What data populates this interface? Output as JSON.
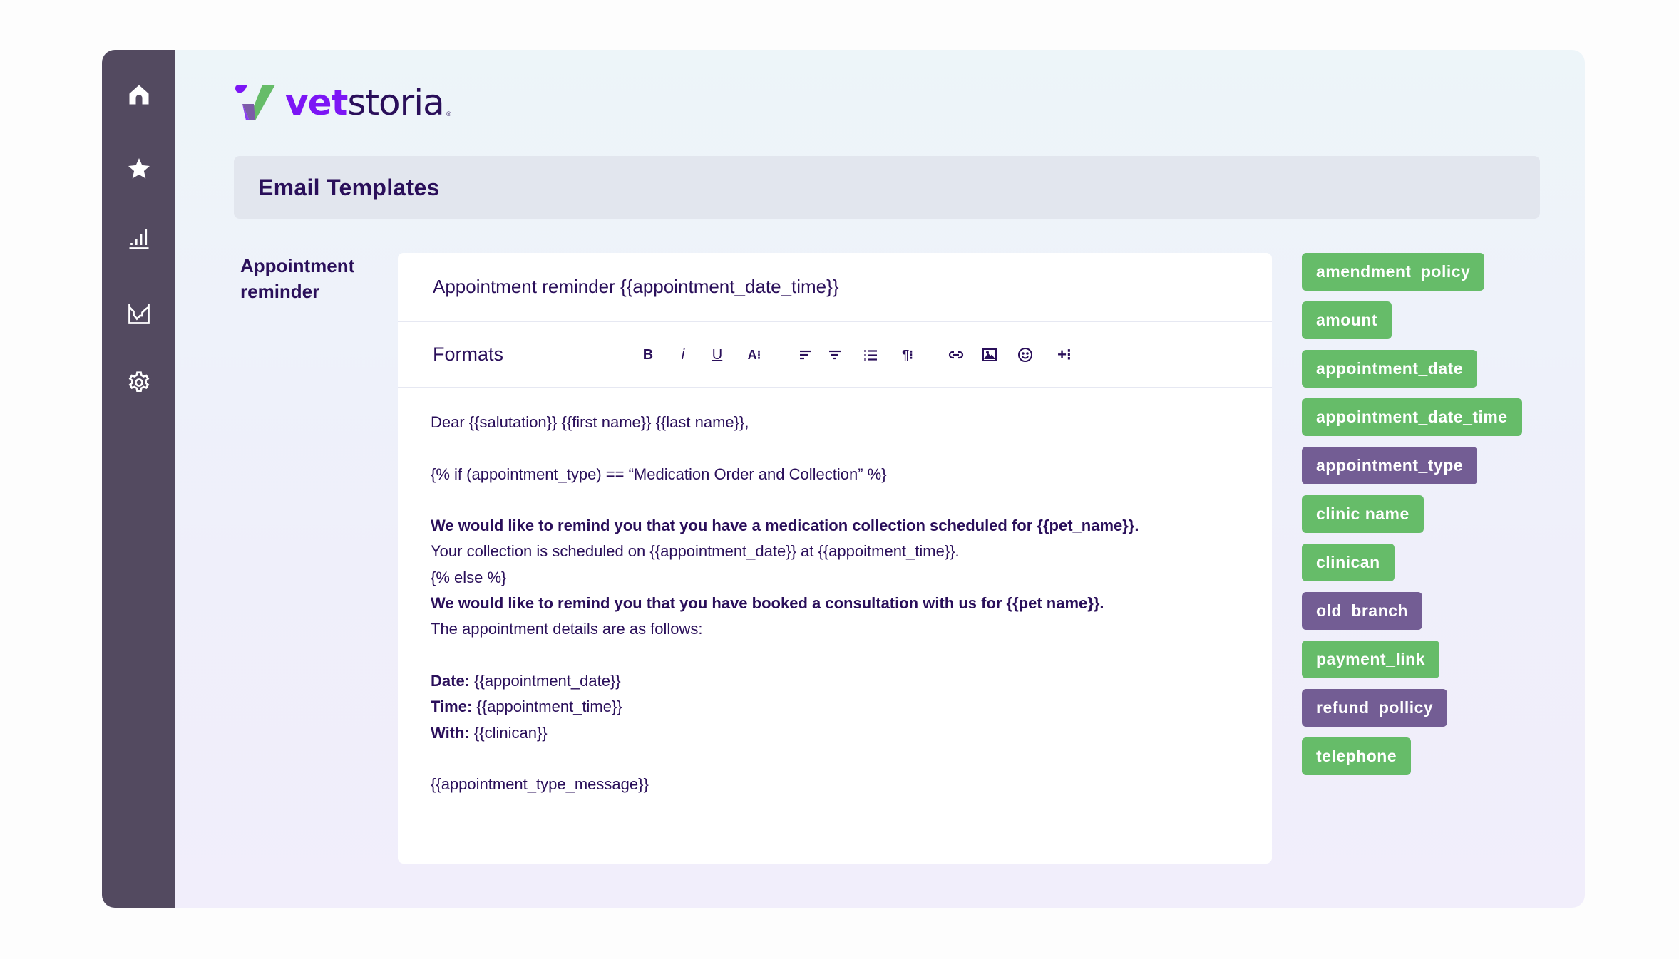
{
  "brand": {
    "name_part1": "vet",
    "name_part2": "storia",
    "registered": "®",
    "colors": {
      "primary_purple": "#7c16f5",
      "dark_text": "#2a0f5a",
      "green": "#66bc69",
      "tag_purple": "#735d94",
      "sidebar": "#534a60"
    }
  },
  "sidebar": {
    "items": [
      {
        "name": "home",
        "icon": "home-icon"
      },
      {
        "name": "favorites",
        "icon": "star-icon"
      },
      {
        "name": "reports",
        "icon": "bar-chart-icon"
      },
      {
        "name": "analytics",
        "icon": "line-chart-icon"
      },
      {
        "name": "settings",
        "icon": "gear-icon"
      }
    ]
  },
  "page": {
    "title": "Email Templates",
    "template_label": "Appointment reminder"
  },
  "editor": {
    "subject": "Appointment reminder {{appointment_date_time}}",
    "toolbar": {
      "formats_label": "Formats",
      "buttons": [
        {
          "name": "bold",
          "glyph": "B"
        },
        {
          "name": "italic",
          "glyph": "i"
        },
        {
          "name": "underline",
          "glyph": "U"
        },
        {
          "name": "font-size",
          "glyph": "A⁝"
        },
        {
          "name": "align-left",
          "glyph": ""
        },
        {
          "name": "align-center",
          "glyph": ""
        },
        {
          "name": "ordered-list",
          "glyph": ""
        },
        {
          "name": "paragraph",
          "glyph": "¶⁝"
        },
        {
          "name": "link",
          "glyph": ""
        },
        {
          "name": "image",
          "glyph": ""
        },
        {
          "name": "emoji",
          "glyph": ""
        },
        {
          "name": "insert-more",
          "glyph": "+⁝"
        }
      ]
    },
    "body": {
      "line1": "Dear {{salutation}} {{first name}} {{last name}},",
      "line2": "{% if (appointment_type) == “Medication Order and Collection” %}",
      "line3": "We would like to remind you that you have a medication collection scheduled for {{pet_name}}.",
      "line4": "Your collection is scheduled on {{appointment_date}} at {{appoitment_time}}.",
      "line5": "{% else %}",
      "line6": "We would like to remind you that you have booked a consultation with us for {{pet name}}.",
      "line7": "The appointment details are as follows:",
      "date_label": "Date:",
      "date_value": " {{appointment_date}}",
      "time_label": "Time:",
      "time_value": " {{appointment_time}}",
      "with_label": "With:",
      "with_value": " {{clinican}}",
      "line_last": "{{appointment_type_message}}"
    }
  },
  "tags": [
    {
      "label": "amendment_policy",
      "color": "green"
    },
    {
      "label": "amount",
      "color": "green"
    },
    {
      "label": "appointment_date",
      "color": "green"
    },
    {
      "label": "appointment_date_time",
      "color": "green"
    },
    {
      "label": "appointment_type",
      "color": "purple"
    },
    {
      "label": "clinic name",
      "color": "green"
    },
    {
      "label": "clinican",
      "color": "green"
    },
    {
      "label": "old_branch",
      "color": "purple"
    },
    {
      "label": "payment_link",
      "color": "green"
    },
    {
      "label": "refund_pollicy",
      "color": "purple"
    },
    {
      "label": "telephone",
      "color": "green"
    }
  ]
}
